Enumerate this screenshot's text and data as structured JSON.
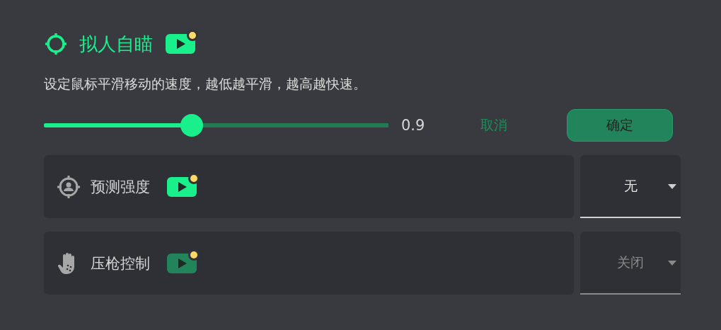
{
  "header": {
    "title": "拟人自瞄"
  },
  "description": "设定鼠标平滑移动的速度，越低越平滑，越高越快速。",
  "slider": {
    "level": 0.43,
    "reading": "0.9"
  },
  "buttons": [
    {
      "kind": "text",
      "label": "取消"
    },
    {
      "kind": "filled",
      "label": "确定"
    }
  ],
  "rows": [
    {
      "kind": "target",
      "label": "预测强度",
      "disabled": false,
      "value": "无"
    },
    {
      "kind": "hand",
      "label": "压枪控制",
      "disabled": true,
      "value": "关闭"
    }
  ]
}
